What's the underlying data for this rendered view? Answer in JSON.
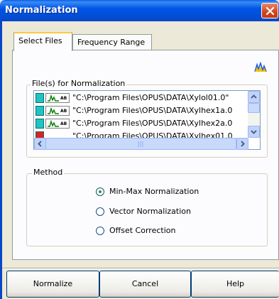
{
  "window": {
    "title": "Normalization"
  },
  "tabs": [
    {
      "label": "Select Files",
      "active": true
    },
    {
      "label": "Frequency Range",
      "active": false
    }
  ],
  "files_group": {
    "label": "File(s) for Normalization",
    "icon_tag": "AB",
    "files": [
      "\"C:\\Program Files\\OPUS\\DATA\\Xylol01.0\"",
      "\"C:\\Program Files\\OPUS\\DATA\\Xylhex1a.0",
      "\"C:\\Program Files\\OPUS\\DATA\\Xylhex2a.0",
      "\"C:\\Program Files\\OPUS\\DATA\\Xylhex01.0"
    ]
  },
  "method_group": {
    "label": "Method",
    "options": [
      {
        "label": "Min-Max Normalization",
        "selected": true
      },
      {
        "label": "Vector Normalization",
        "selected": false
      },
      {
        "label": "Offset Correction",
        "selected": false
      }
    ]
  },
  "buttons": {
    "normalize": "Normalize",
    "cancel": "Cancel",
    "help": "Help"
  },
  "colors": {
    "titlebar": "#0055E5",
    "close": "#D2451E",
    "dialog_bg": "#ECE9D8",
    "tab_highlight": "#FFC83C"
  },
  "icons": [
    "close-icon",
    "spectrum-icon",
    "scroll-up-icon",
    "scroll-down-icon",
    "scroll-left-icon",
    "scroll-right-icon",
    "select-files-icon"
  ]
}
